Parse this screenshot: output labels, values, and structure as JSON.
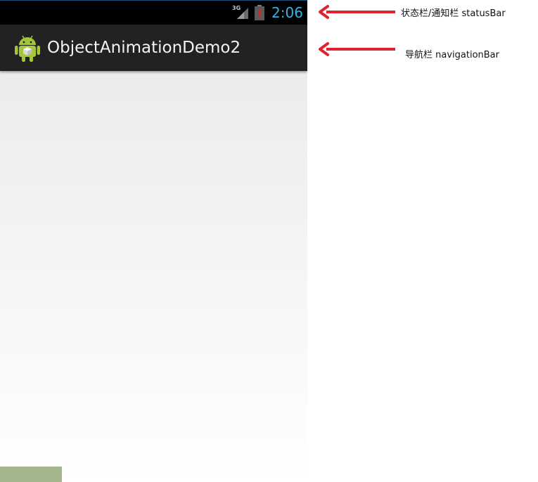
{
  "status_bar": {
    "network": "3G",
    "time": "2:06",
    "icons": [
      "signal-icon",
      "battery-alert-icon"
    ],
    "time_color": "#33b5e5"
  },
  "action_bar": {
    "app_icon": "android-app-icon",
    "title": "ObjectAnimationDemo2"
  },
  "content": {
    "green_view_color": "#a4b68b"
  },
  "annotations": {
    "status_bar_label": "状态栏/通知栏  statusBar",
    "navigation_bar_label": "导航栏  navigationBar",
    "arrow_color": "#e0222e"
  }
}
